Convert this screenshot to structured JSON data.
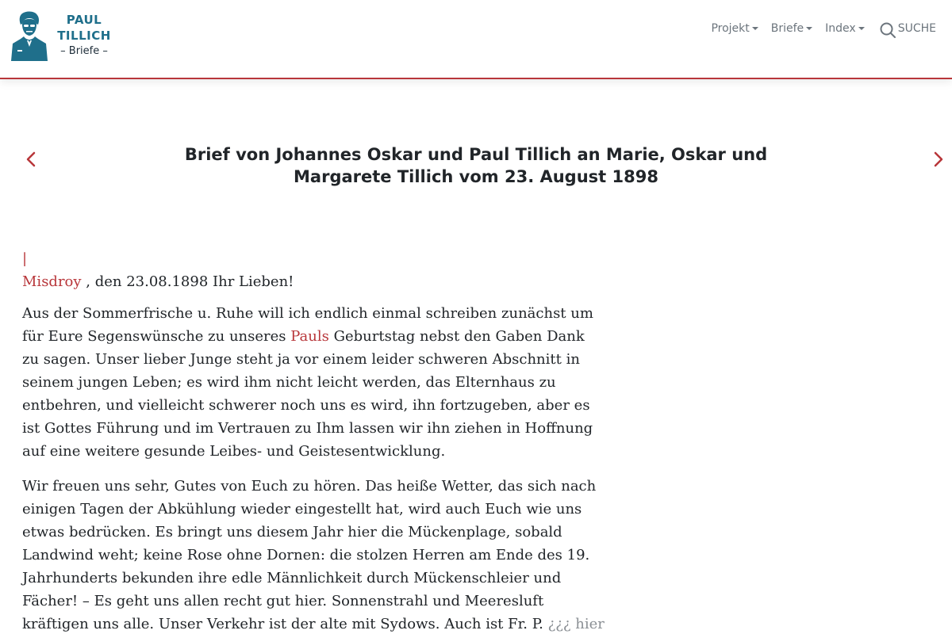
{
  "header": {
    "logo": {
      "line1": "PAUL",
      "line2": "TILLICH",
      "line3": "– Briefe –"
    },
    "nav": [
      {
        "label": "Projekt",
        "icon": "caret-down-icon"
      },
      {
        "label": "Briefe",
        "icon": "caret-down-icon"
      },
      {
        "label": "Index",
        "icon": "caret-down-icon"
      }
    ],
    "search_label": "SUCHE",
    "accent_color": "#b8363a",
    "logo_color": "#1f6f8b"
  },
  "letter": {
    "title": "Brief von Johannes Oskar und Paul Tillich an Marie, Oskar und Margarete Tillich vom 23. August 1898",
    "pagebreak": "|",
    "place": "Misdroy",
    "date_line": " , den 23.08.1898 Ihr Lieben!",
    "p1_a": "Aus der Sommerfrische u. Ruhe will ich endlich einmal schreiben zunächst um für Eure Segenswünsche zu unseres ",
    "p1_link": "Pauls",
    "p1_b": " Geburtstag nebst den Gaben Dank zu sagen. Unser lieber Junge steht ja vor einem leider schweren Abschnitt in seinem jungen Leben; es wird ihm nicht leicht werden, das Elternhaus zu entbehren, und vielleicht schwerer noch uns es wird, ihn fortzugeben, aber es ist Gottes Führung und im Vertrauen zu Ihm lassen wir ihn ziehen in Hoffnung auf eine weitere gesunde Leibes- und Geistesentwicklung.",
    "p2_a": "Wir freuen uns sehr, Gutes von Euch zu hören. Das heiße Wetter, das sich nach einigen Tagen der Abkühlung wieder eingestellt hat, wird auch Euch wie uns etwas bedrücken. Es bringt uns diesem Jahr hier die Mückenplage, sobald Landwind weht; keine Rose ohne Dornen: die stolzen Herren am Ende des 19. Jahrhunderts bekunden ihre edle Männlichkeit durch Mückenschleier und Fächer! – Es geht uns allen recht gut hier. Sonnenstrahl und Meeresluft kräftigen uns alle. Unser Verkehr ist der alte mit Sydows. Auch ist Fr. P. ",
    "p2_uncertain": "¿¿¿ hier"
  }
}
